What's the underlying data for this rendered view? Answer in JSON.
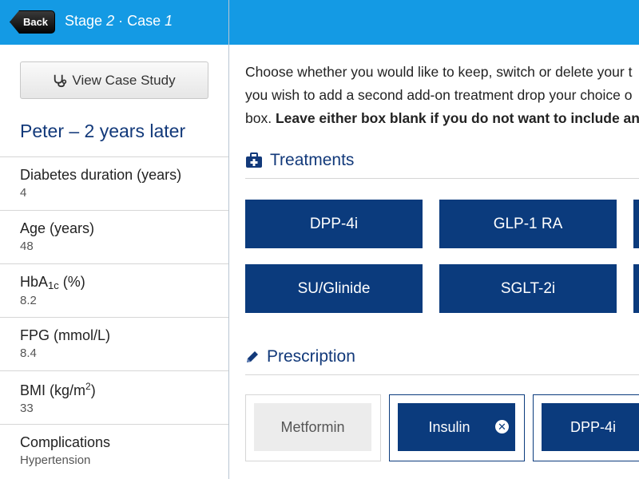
{
  "nav": {
    "back_label": "Back",
    "title_stage": "Stage",
    "title_stage_num": "2",
    "title_sep": "·",
    "title_case": "Case",
    "title_case_num": "1"
  },
  "sidebar": {
    "case_button_label": "View Case Study",
    "patient_title": "Peter – 2 years later",
    "stats": [
      {
        "label": "Diabetes duration (years)",
        "value": "4"
      },
      {
        "label": "Age (years)",
        "value": "48"
      },
      {
        "label_main": "HbA",
        "label_sub": "1c",
        "label_rest": " (%)",
        "value": "8.2"
      },
      {
        "label": "FPG (mmol/L)",
        "value": "8.4"
      },
      {
        "label_main": "BMI (kg/m",
        "label_sup": "2",
        "label_rest": ")",
        "value": "33"
      },
      {
        "label": "Complications",
        "value": "Hypertension"
      }
    ]
  },
  "main": {
    "instructions": {
      "line1": "Choose whether you would like to keep, switch or delete your t",
      "line2": "you wish to add a second add-on treatment drop your choice o",
      "line3_plain": "box. ",
      "line3_bold": "Leave either box blank if you do not want to include any t"
    },
    "treatments": {
      "heading": "Treatments",
      "items": [
        "DPP-4i",
        "GLP-1 RA",
        "SU/Glinide",
        "SGLT-2i"
      ]
    },
    "prescription": {
      "heading": "Prescription",
      "items": [
        "Metformin",
        "Insulin",
        "DPP-4i"
      ]
    }
  },
  "colors": {
    "nav_bg": "#149ae4",
    "brand_navy": "#0b3b7d",
    "heading": "#12397a"
  }
}
